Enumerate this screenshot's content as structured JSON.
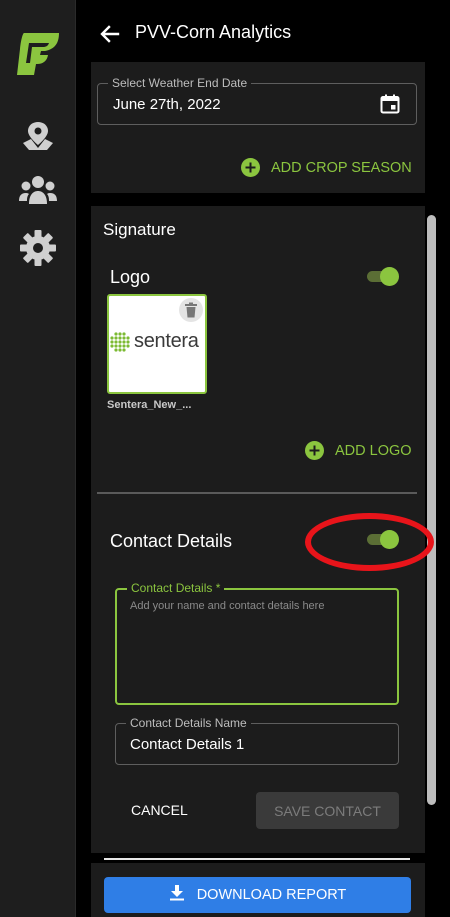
{
  "app": {
    "page_title": "PVV-Corn Analytics"
  },
  "sidebar": {
    "items": [
      {
        "name": "map-icon"
      },
      {
        "name": "users-icon"
      },
      {
        "name": "settings-icon"
      }
    ]
  },
  "crop_season": {
    "weather_end_date_label": "Select Weather End Date",
    "weather_end_date_value": "June 27th, 2022",
    "add_crop_season_label": "ADD CROP SEASON"
  },
  "signature": {
    "title": "Signature",
    "logo": {
      "title": "Logo",
      "toggle_on": true,
      "image_logo_text": "sentera",
      "file_name": "Sentera_New_...",
      "add_logo_label": "ADD LOGO"
    },
    "contact": {
      "title": "Contact Details",
      "toggle_on": true,
      "details_label": "Contact Details *",
      "details_placeholder": "Add your name and contact details here",
      "details_value": "",
      "name_label": "Contact Details Name",
      "name_value": "Contact Details 1",
      "cancel_label": "CANCEL",
      "save_label": "SAVE CONTACT"
    }
  },
  "footer": {
    "download_label": "DOWNLOAD REPORT"
  },
  "colors": {
    "accent_green": "#8bc53f",
    "primary_blue": "#2f7ee6",
    "annotation_red": "#e8141a",
    "panel_bg": "#1c1c1c"
  }
}
